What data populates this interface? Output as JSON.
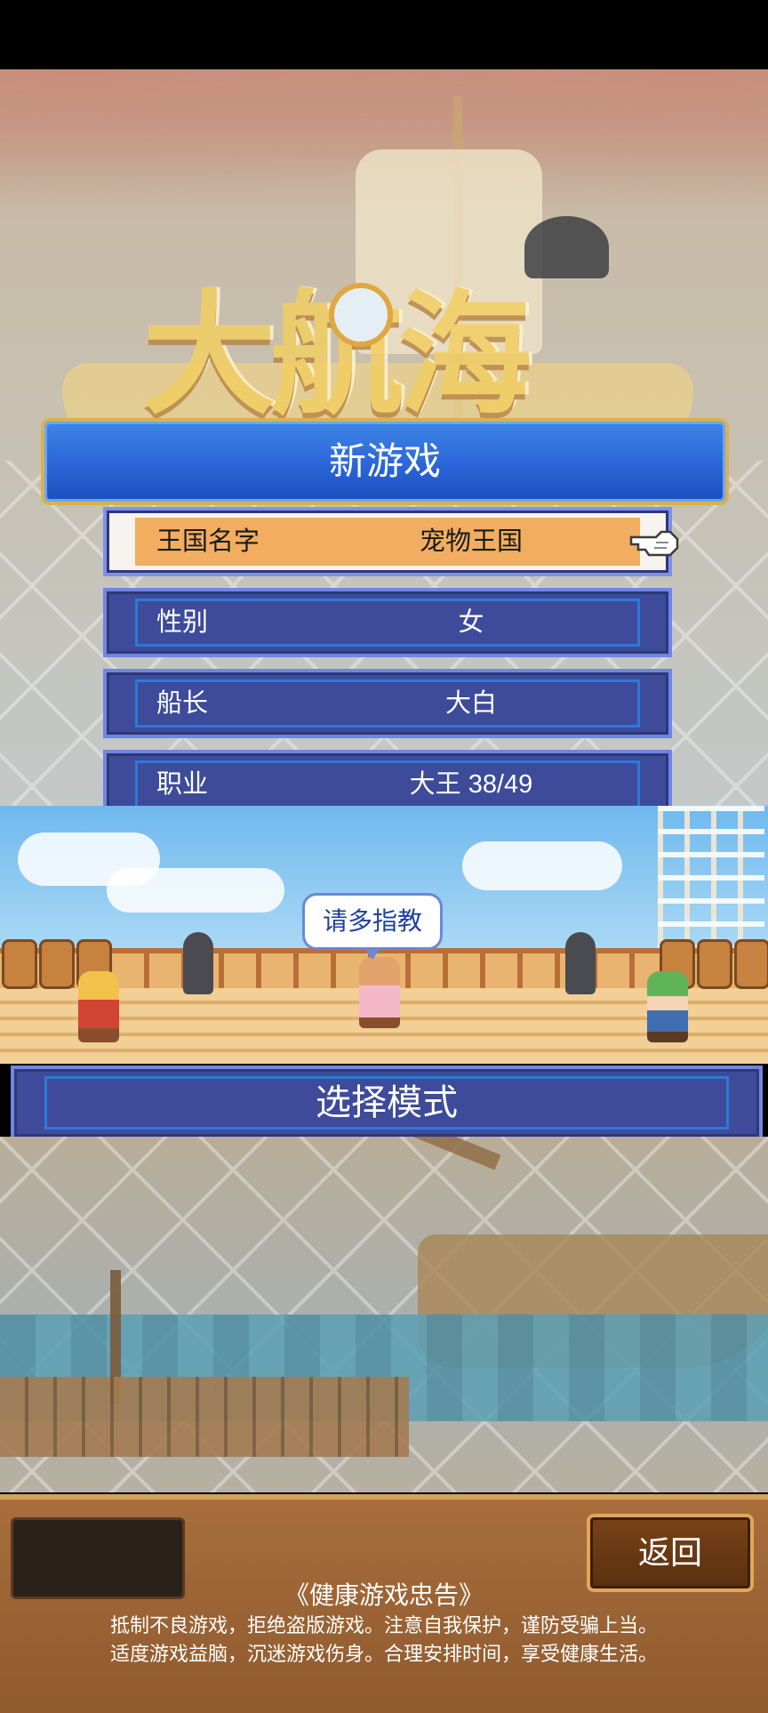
{
  "banner": {
    "title": "新游戏"
  },
  "settings": {
    "rows": [
      {
        "label": "王国名字",
        "value": "宠物王国"
      },
      {
        "label": "性别",
        "value": "女"
      },
      {
        "label": "船长",
        "value": "大白"
      },
      {
        "label": "职业",
        "value": "大王 38/49"
      }
    ]
  },
  "deck": {
    "speech": "请多指教"
  },
  "mode": {
    "label": "选择模式"
  },
  "footer": {
    "back_label": "返回",
    "notice_title": "《健康游戏忠告》",
    "notice_line1": "抵制不良游戏，拒绝盗版游戏。注意自我保护，谨防受骗上当。",
    "notice_line2": "适度游戏益脑，沉迷游戏伤身。合理安排时间，享受健康生活。"
  },
  "colors": {
    "banner_blue": "#2a65d8",
    "row_blue": "#3d4b9a",
    "selected_orange": "#f2ad60",
    "footer_brown": "#a86e3c"
  }
}
